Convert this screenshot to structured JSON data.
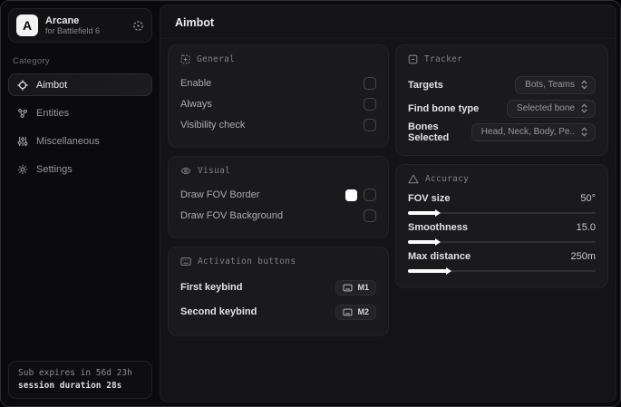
{
  "app": {
    "logo_letter": "A",
    "name": "Arcane",
    "subtitle": "for Battlefield 6"
  },
  "colors": {
    "fov_border_swatch": "#ffffff"
  },
  "sidebar": {
    "category_label": "Category",
    "items": [
      {
        "label": "Aimbot",
        "icon": "crosshair-icon",
        "active": true
      },
      {
        "label": "Entities",
        "icon": "entities-icon",
        "active": false
      },
      {
        "label": "Miscellaneous",
        "icon": "sliders-icon",
        "active": false
      },
      {
        "label": "Settings",
        "icon": "gear-icon",
        "active": false
      }
    ],
    "subscription": {
      "expires": "Sub expires in 56d 23h",
      "session": "session duration 28s"
    }
  },
  "main": {
    "title": "Aimbot",
    "general": {
      "title": "General",
      "rows": [
        {
          "label": "Enable",
          "checked": false
        },
        {
          "label": "Always",
          "checked": false
        },
        {
          "label": "Visibility check",
          "checked": false
        }
      ]
    },
    "visual": {
      "title": "Visual",
      "rows": [
        {
          "label": "Draw FOV Border",
          "checked": false,
          "swatch": "#ffffff"
        },
        {
          "label": "Draw FOV Background",
          "checked": false
        }
      ]
    },
    "activation": {
      "title": "Activation buttons",
      "rows": [
        {
          "label": "First keybind",
          "key": "M1"
        },
        {
          "label": "Second keybind",
          "key": "M2"
        }
      ]
    },
    "tracker": {
      "title": "Tracker",
      "rows": [
        {
          "label": "Targets",
          "value": "Bots, Teams"
        },
        {
          "label": "Find bone type",
          "value": "Selected bone"
        },
        {
          "label": "Bones Selected",
          "value": "Head, Neck, Body, Pe.."
        }
      ]
    },
    "accuracy": {
      "title": "Accuracy",
      "sliders": [
        {
          "label": "FOV size",
          "value": "50°",
          "percent": 15
        },
        {
          "label": "Smoothness",
          "value": "15.0",
          "percent": 15
        },
        {
          "label": "Max distance",
          "value": "250m",
          "percent": 21
        }
      ]
    }
  }
}
